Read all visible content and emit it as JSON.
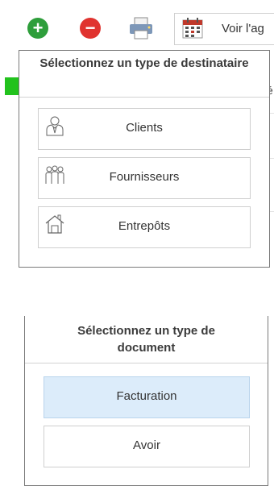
{
  "toolbar": {
    "add_icon": "plus-circle-icon",
    "remove_icon": "minus-circle-icon",
    "print_icon": "printer-icon",
    "calendar_icon": "calendar-icon",
    "agenda_label": "Voir l'ag"
  },
  "recipient_popup": {
    "title": "Sélectionnez un type de destinataire",
    "options": [
      {
        "label": "Clients",
        "icon": "person-icon"
      },
      {
        "label": "Fournisseurs",
        "icon": "group-icon"
      },
      {
        "label": "Entrepôts",
        "icon": "warehouse-icon"
      }
    ]
  },
  "document_popup": {
    "title": "Sélectionnez un type de document",
    "options": [
      {
        "label": "Facturation",
        "selected": true
      },
      {
        "label": "Avoir",
        "selected": false
      }
    ]
  },
  "background": {
    "partial_letter": "é"
  },
  "colors": {
    "add_green": "#2e9e3b",
    "remove_red": "#e0332f",
    "selected_option_bg": "#dcecfa",
    "green_strip": "#22c21d"
  }
}
